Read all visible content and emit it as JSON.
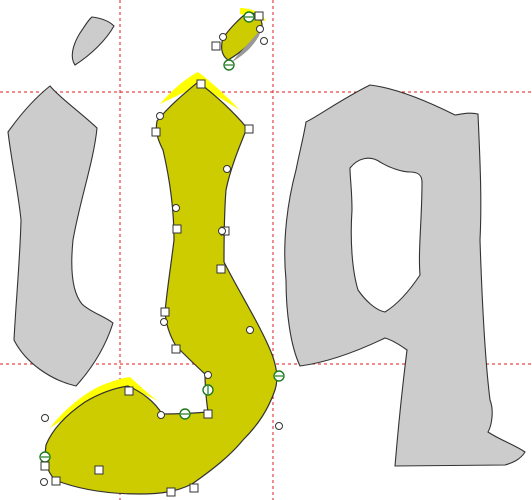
{
  "editor": {
    "guide_color": "#e01818",
    "glyph_fill": "#cccccc",
    "selected_fill": "#cccc00",
    "highlight_color": "#ffff00",
    "node_style": "square-and-circle editing handles",
    "start_node_color": "#1f7a1f"
  },
  "glyphs": [
    {
      "name": "dotless-i",
      "selected": false
    },
    {
      "name": "i-dot",
      "selected": false
    },
    {
      "name": "j",
      "selected": true
    },
    {
      "name": "j-dot",
      "selected": true
    },
    {
      "name": "q",
      "selected": false
    }
  ]
}
